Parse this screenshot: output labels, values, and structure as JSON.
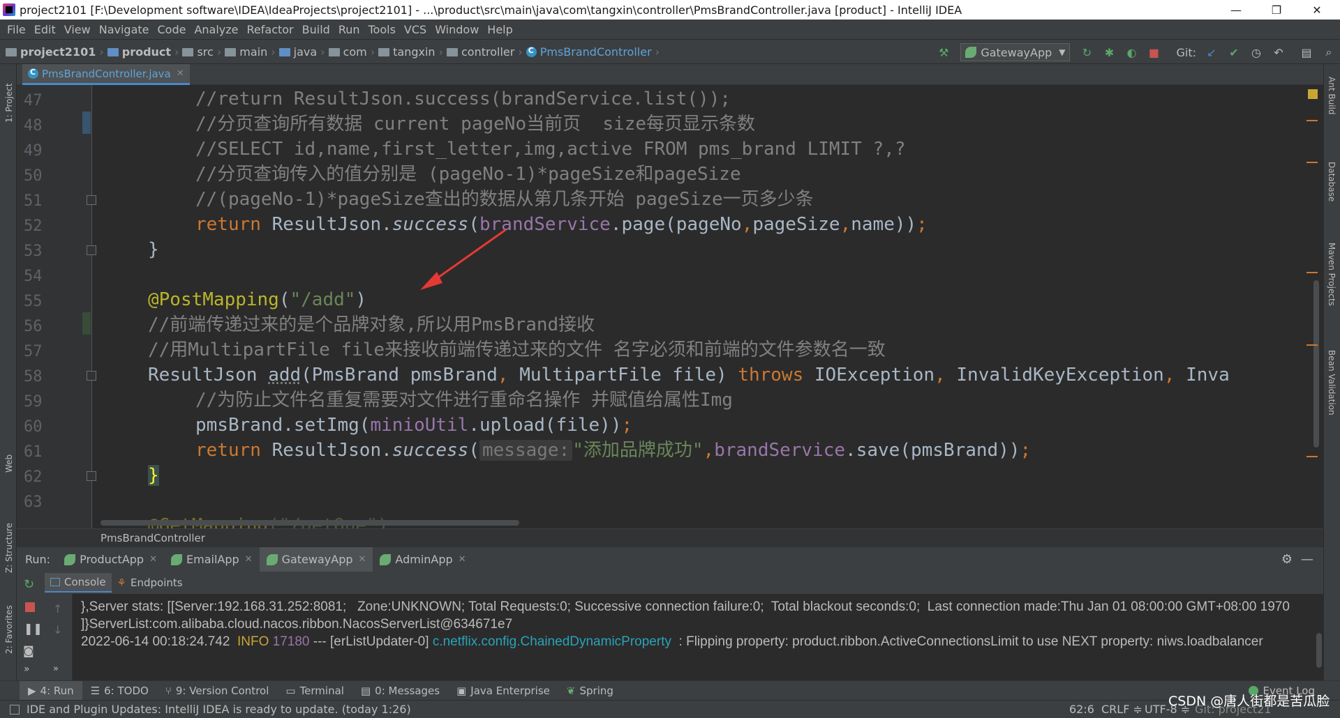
{
  "window": {
    "title": "project2101 [F:\\Development software\\IDEA\\IdeaProjects\\project2101] - ...\\product\\src\\main\\java\\com\\tangxin\\controller\\PmsBrandController.java [product] - IntelliJ IDEA",
    "minimize": "—",
    "restore": "❐",
    "close": "✕"
  },
  "menu": [
    "File",
    "Edit",
    "View",
    "Navigate",
    "Code",
    "Analyze",
    "Refactor",
    "Build",
    "Run",
    "Tools",
    "VCS",
    "Window",
    "Help"
  ],
  "breadcrumb": [
    "project2101",
    "product",
    "src",
    "main",
    "java",
    "com",
    "tangxin",
    "controller",
    "PmsBrandController"
  ],
  "toolbar": {
    "run_config": "GatewayApp",
    "git_label": "Git:"
  },
  "editor_tab": "PmsBrandController.java",
  "left_strip": [
    "1: Project",
    "Web",
    "Z: Structure",
    "2: Favorites"
  ],
  "right_strip": [
    "Ant Build",
    "Database",
    "Maven Projects",
    "Bean Validation"
  ],
  "line_numbers": [
    "47",
    "48",
    "49",
    "50",
    "51",
    "52",
    "53",
    "54",
    "55",
    "56",
    "57",
    "58",
    "59",
    "60",
    "61",
    "62",
    "63"
  ],
  "code": {
    "l47": "//return ResultJson.success(brandService.list());",
    "l48": "//分页查询所有数据 current pageNo当前页  size每页显示条数",
    "l49": "//SELECT id,name,first_letter,img,active FROM pms_brand LIMIT ?,?",
    "l50": "//分页查询传入的值分别是 (pageNo-1)*pageSize和pageSize",
    "l51": "//(pageNo-1)*pageSize查出的数据从第几条开始 pageSize一页多少条",
    "l52_kw": "return",
    "l52_a": " ResultJson.",
    "l52_m": "success",
    "l52_b": "(",
    "l52_f": "brandService",
    "l52_c": ".page(pageNo",
    "l52_d": ",",
    "l52_e": "pageSize",
    "l52_g": ",",
    "l52_h": "name))",
    "l52_semi": ";",
    "l53": "}",
    "l55_an": "@PostMapping",
    "l55_a": "(",
    "l55_str": "\"/add\"",
    "l55_b": ")",
    "l56": "//前端传递过来的是个品牌对象,所以用PmsBrand接收",
    "l57": "//用MultipartFile file来接收前端传递过来的文件 名字必须和前端的文件参数名一致",
    "l58_a": "ResultJson ",
    "l58_m": "add",
    "l58_b": "(PmsBrand pmsBrand",
    "l58_c": ", ",
    "l58_d": "MultipartFile file) ",
    "l58_kw": "throws",
    "l58_e": " IOException",
    "l58_f": ", ",
    "l58_g": "InvalidKeyException",
    "l58_h": ", ",
    "l58_i": "Inva",
    "l59": "//为防止文件名重复需要对文件进行重命名操作 并赋值给属性Img",
    "l60_a": "pmsBrand.setImg(",
    "l60_f": "minioUtil",
    "l60_b": ".upload(file))",
    "l60_semi": ";",
    "l61_kw": "return",
    "l61_a": " ResultJson.",
    "l61_m": "success",
    "l61_b": "(",
    "l61_hint": "message:",
    "l61_str": "\"添加品牌成功\"",
    "l61_c": ",",
    "l61_f": "brandService",
    "l61_d": ".save(pmsBrand))",
    "l61_semi": ";",
    "l62": "}",
    "l64_an": "@GetMapping",
    "l64_str": "(\"/getOne\")"
  },
  "editor_breadcrumb": "PmsBrandController",
  "run": {
    "label": "Run:",
    "tabs": [
      "ProductApp",
      "EmailApp",
      "GatewayApp",
      "AdminApp"
    ],
    "subtabs": [
      "Console",
      "Endpoints"
    ]
  },
  "console_lines": [
    "},Server stats: [[Server:192.168.31.252:8081;   Zone:UNKNOWN; Total Requests:0; Successive connection failure:0;  Total blackout seconds:0;  Last connection made:Thu Jan 01 08:00:00 GMT+08:00 1970",
    "]}ServerList:com.alibaba.cloud.nacos.ribbon.NacosServerList@634671e7"
  ],
  "console_line3": {
    "ts": "2022-06-14 00:18:24.742  ",
    "level": "INFO",
    "pid": " 17180",
    "rest": " --- [erListUpdater-0] ",
    "logger": "c.netflix.config.ChainedDynamicProperty",
    "msg": "  : Flipping property: product.ribbon.ActiveConnectionsLimit to use NEXT property: niws.loadbalancer"
  },
  "bottom_tabs": [
    "4: Run",
    "6: TODO",
    "9: Version Control",
    "Terminal",
    "0: Messages",
    "Java Enterprise",
    "Spring"
  ],
  "event_log": "Event Log",
  "status": {
    "message": "IDE and Plugin Updates: IntelliJ IDEA is ready to update. (today 1:26)",
    "position": "62:6",
    "line_sep": "CRLF ≑",
    "encoding": "UTF-8 ≑",
    "git": "Git: project21",
    "watermark": "CSDN @唐人街都是苦瓜脸"
  },
  "colors": {
    "accent": "#4a88c7",
    "keyword": "#cc7832",
    "string": "#6a8759",
    "annotation": "#bbb529",
    "comment": "#808080",
    "field": "#9876aa"
  }
}
